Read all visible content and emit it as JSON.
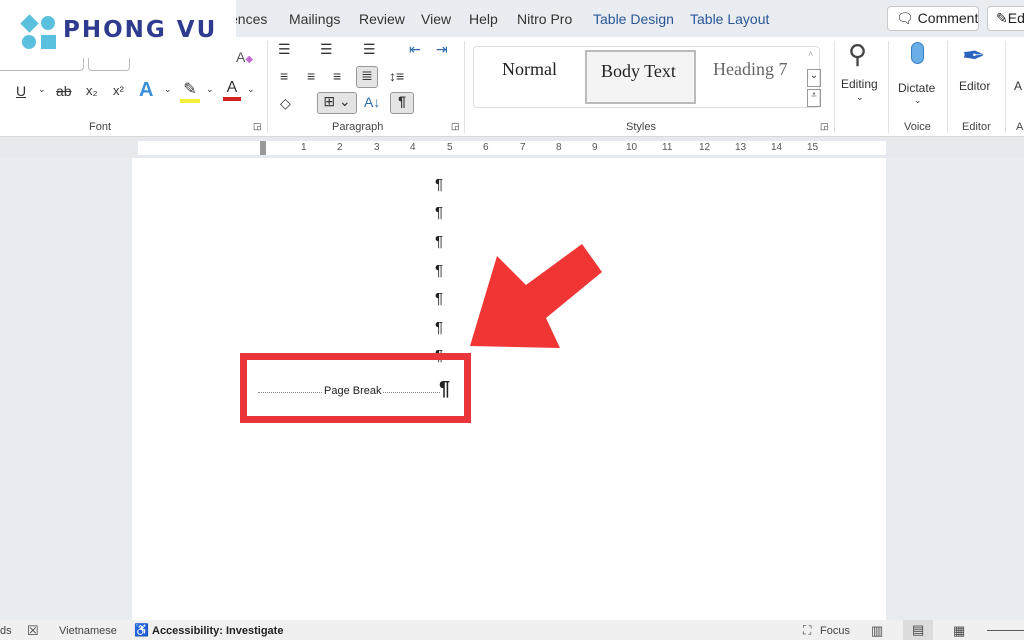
{
  "brand": {
    "name": "PHONG VU",
    "color": "#2e3b8f",
    "accent": "#5bc0de"
  },
  "tabs": [
    {
      "label": "ences"
    },
    {
      "label": "Mailings"
    },
    {
      "label": "Review"
    },
    {
      "label": "View"
    },
    {
      "label": "Help"
    },
    {
      "label": "Nitro Pro"
    },
    {
      "label": "Table Design"
    },
    {
      "label": "Table Layout"
    }
  ],
  "top_buttons": {
    "comments": "Comments",
    "editing": "Ed"
  },
  "ribbon": {
    "groups": {
      "font": "Font",
      "paragraph": "Paragraph",
      "styles": "Styles",
      "voice": "Voice",
      "editor": "Editor",
      "more": "A"
    },
    "font_icons": {
      "underline": "U",
      "strike": "ab",
      "subscript": "x₂",
      "superscript": "x²",
      "text_effects": "A",
      "font_color": "A"
    },
    "styles": [
      {
        "label": "Normal"
      },
      {
        "label": "Body Text",
        "selected": true
      },
      {
        "label": "Heading 7"
      }
    ],
    "editing": "Editing",
    "dictate": "Dictate",
    "editor": "Editor",
    "add_ins": "A",
    "pilcrow": "¶",
    "sort": "A↓"
  },
  "ruler": {
    "numbers": [
      "1",
      "2",
      "3",
      "4",
      "5",
      "6",
      "7",
      "8",
      "9",
      "10",
      "11",
      "12",
      "13",
      "14",
      "15"
    ]
  },
  "document": {
    "pilcrows": [
      "¶",
      "¶",
      "¶",
      "¶",
      "¶",
      "¶",
      "¶"
    ],
    "page_break_label": "Page Break",
    "page_break_mark": "¶",
    "highlight_color": "#e8353a"
  },
  "status": {
    "words": "ds",
    "language": "Vietnamese",
    "accessibility": "Accessibility: Investigate",
    "focus": "Focus"
  }
}
